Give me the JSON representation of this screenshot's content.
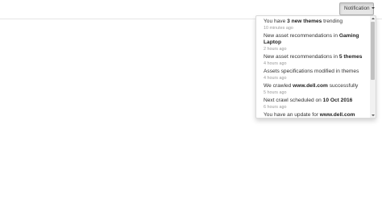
{
  "header": {
    "notification_button": {
      "label": "Notification",
      "icon": "caret-down-icon"
    }
  },
  "notifications": [
    {
      "parts": [
        {
          "text": "You have "
        },
        {
          "text": "3 new themes",
          "bold": true
        },
        {
          "text": " trending"
        }
      ],
      "time": "10 minutes ago"
    },
    {
      "parts": [
        {
          "text": "New asset recommendations in "
        },
        {
          "text": "Gaming Laptop",
          "bold": true
        }
      ],
      "time": "2 hours ago"
    },
    {
      "parts": [
        {
          "text": "New asset recommendations in "
        },
        {
          "text": "5 themes",
          "bold": true
        }
      ],
      "time": "4 hours ago"
    },
    {
      "parts": [
        {
          "text": "Assets specifications modified in themes"
        }
      ],
      "time": "4 hours ago"
    },
    {
      "parts": [
        {
          "text": "We crawled "
        },
        {
          "text": "www.dell.com",
          "bold": true
        },
        {
          "text": " successfully"
        }
      ],
      "time": "5 hours ago"
    },
    {
      "parts": [
        {
          "text": "Next crawl scheduled on "
        },
        {
          "text": "10 Oct 2016",
          "bold": true
        }
      ],
      "time": "6 hours ago"
    },
    {
      "parts": [
        {
          "text": "You have an update for "
        },
        {
          "text": "www.dell.com",
          "bold": true
        }
      ],
      "time": ""
    }
  ],
  "scrollbar": {
    "position": 0
  }
}
